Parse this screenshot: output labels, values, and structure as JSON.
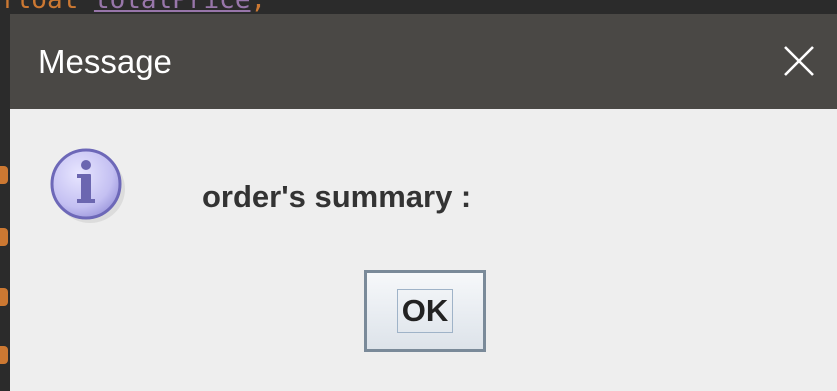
{
  "background_editor": {
    "code_line": {
      "keyword": "float",
      "identifier": "totalPrice",
      "punctuation": ";"
    }
  },
  "dialog": {
    "title": "Message",
    "message": "order's summary :",
    "icon": "info-icon",
    "buttons": {
      "ok_label": "OK"
    }
  },
  "colors": {
    "titlebar": "#4a4845",
    "content_background": "#eeeeee",
    "editor_background": "#2b2b2b",
    "keyword_color": "#cc7832",
    "identifier_color": "#9876aa"
  }
}
